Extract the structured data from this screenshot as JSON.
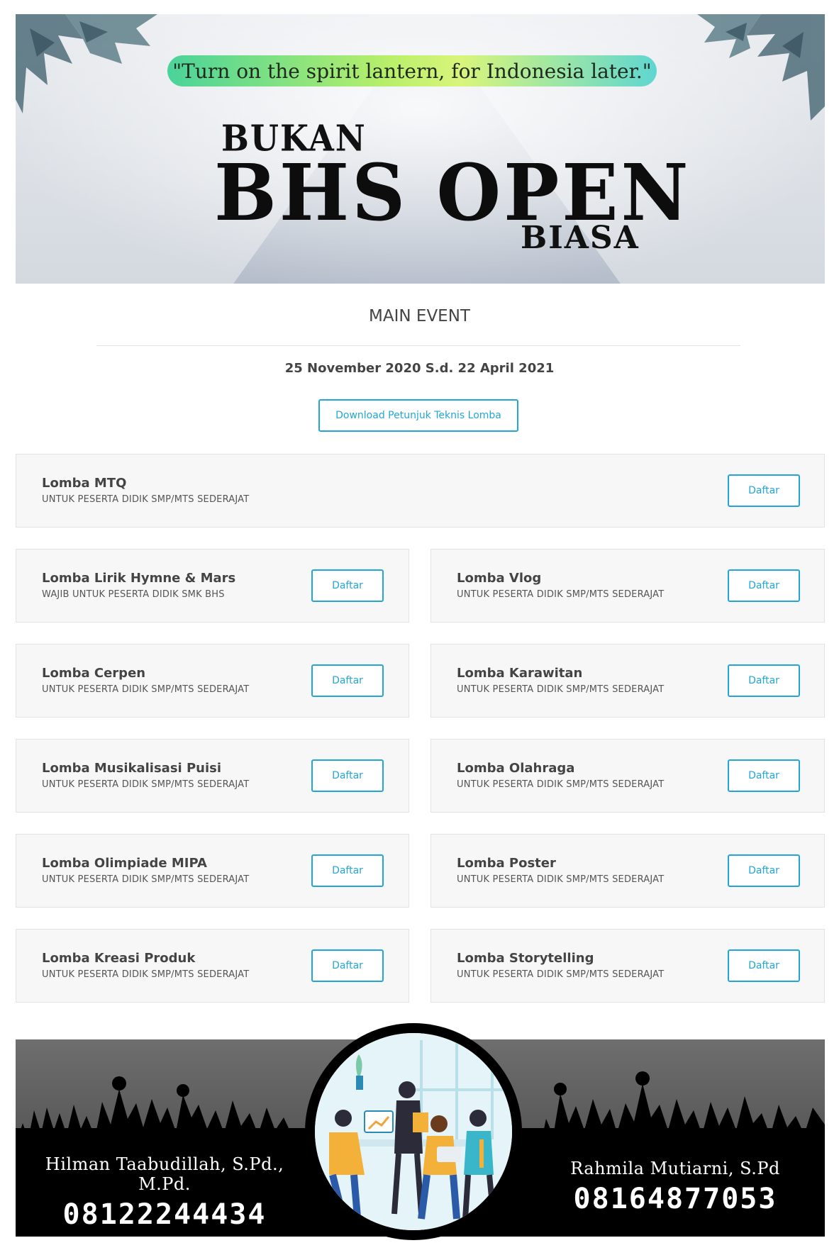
{
  "banner": {
    "quote": "\"Turn on the spirit lantern, for Indonesia later.\"",
    "title_top": "BUKAN",
    "title_main": "BHS OPEN",
    "title_bottom": "BIASA"
  },
  "main": {
    "section_title": "MAIN EVENT",
    "date_range": "25 November 2020 S.d. 22 April 2021",
    "download_label": "Download Petunjuk Teknis Lomba"
  },
  "competitions": [
    {
      "name": "Lomba MTQ",
      "note": "UNTUK PESERTA DIDIK SMP/MTS SEDERAJAT",
      "button": "Daftar"
    },
    {
      "name": "Lomba Lirik Hymne & Mars",
      "note": "WAJIB UNTUK PESERTA DIDIK SMK BHS",
      "button": "Daftar"
    },
    {
      "name": "Lomba Vlog",
      "note": "UNTUK PESERTA DIDIK SMP/MTS SEDERAJAT",
      "button": "Daftar"
    },
    {
      "name": "Lomba Cerpen",
      "note": "UNTUK PESERTA DIDIK SMP/MTS SEDERAJAT",
      "button": "Daftar"
    },
    {
      "name": "Lomba Karawitan",
      "note": "UNTUK PESERTA DIDIK SMP/MTS SEDERAJAT",
      "button": "Daftar"
    },
    {
      "name": "Lomba Musikalisasi Puisi",
      "note": "UNTUK PESERTA DIDIK SMP/MTS SEDERAJAT",
      "button": "Daftar"
    },
    {
      "name": "Lomba Olahraga",
      "note": "UNTUK PESERTA DIDIK SMP/MTS SEDERAJAT",
      "button": "Daftar"
    },
    {
      "name": "Lomba Olimpiade MIPA",
      "note": "UNTUK PESERTA DIDIK SMP/MTS SEDERAJAT",
      "button": "Daftar"
    },
    {
      "name": "Lomba Poster",
      "note": "UNTUK PESERTA DIDIK SMP/MTS SEDERAJAT",
      "button": "Daftar"
    },
    {
      "name": "Lomba Kreasi Produk",
      "note": "UNTUK PESERTA DIDIK SMP/MTS SEDERAJAT",
      "button": "Daftar"
    },
    {
      "name": "Lomba Storytelling",
      "note": "UNTUK PESERTA DIDIK SMP/MTS SEDERAJAT",
      "button": "Daftar"
    }
  ],
  "footer": {
    "contact_left": {
      "name": "Hilman Taabudillah, S.Pd., M.Pd.",
      "phone": "08122244434"
    },
    "contact_right": {
      "name": "Rahmila Mutiarni, S.Pd",
      "phone": "08164877053"
    }
  },
  "colors": {
    "accent": "#23a6d5",
    "card_bg": "#f7f7f7",
    "card_border": "#e3e3e3"
  }
}
